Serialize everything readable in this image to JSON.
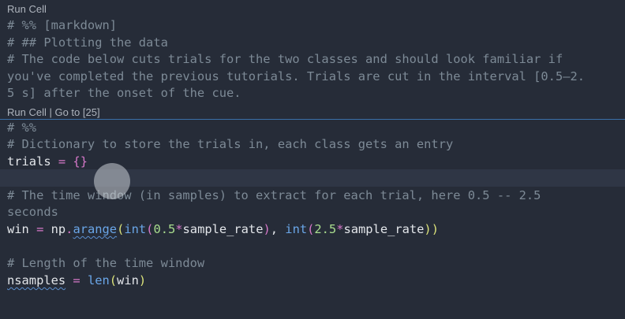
{
  "codelens": {
    "cell1_run": "Run Cell",
    "cell2_run": "Run Cell",
    "cell2_sep": " | ",
    "cell2_goto": "Go to [25]"
  },
  "code": {
    "l1": "# %% [markdown]",
    "l2": "# ## Plotting the data",
    "l3": "# The code below cuts trials for the two classes and should look familiar if",
    "l4": "you've completed the previous tutorials. Trials are cut in the interval [0.5–2.",
    "l5": "5 s] after the onset of the cue.",
    "l6": "# %%",
    "l7": "# Dictionary to store the trials in, each class gets an entry",
    "l8_var": "trials",
    "l8_op": " = ",
    "l8_val": "{}",
    "l10": "# The time window (in samples) to extract for each trial, here 0.5 -- 2.5",
    "l11": "seconds",
    "l12_var": "win",
    "l12_op": " = ",
    "l12_np": "np",
    "l12_dot": ".",
    "l12_fn": "arange",
    "l12_p1": "(",
    "l12_int1": "int",
    "l12_p2": "(",
    "l12_n1": "0.5",
    "l12_mul1": "*",
    "l12_sr1": "sample_rate",
    "l12_p3": ")",
    "l12_comma": ", ",
    "l12_int2": "int",
    "l12_p4": "(",
    "l12_n2": "2.5",
    "l12_mul2": "*",
    "l12_sr2": "sample_rate",
    "l12_p5": "))",
    "l14": "# Length of the time window",
    "l15_var": "nsamples",
    "l15_op": " = ",
    "l15_fn": "len",
    "l15_p1": "(",
    "l15_arg": "win",
    "l15_p2": ")"
  }
}
